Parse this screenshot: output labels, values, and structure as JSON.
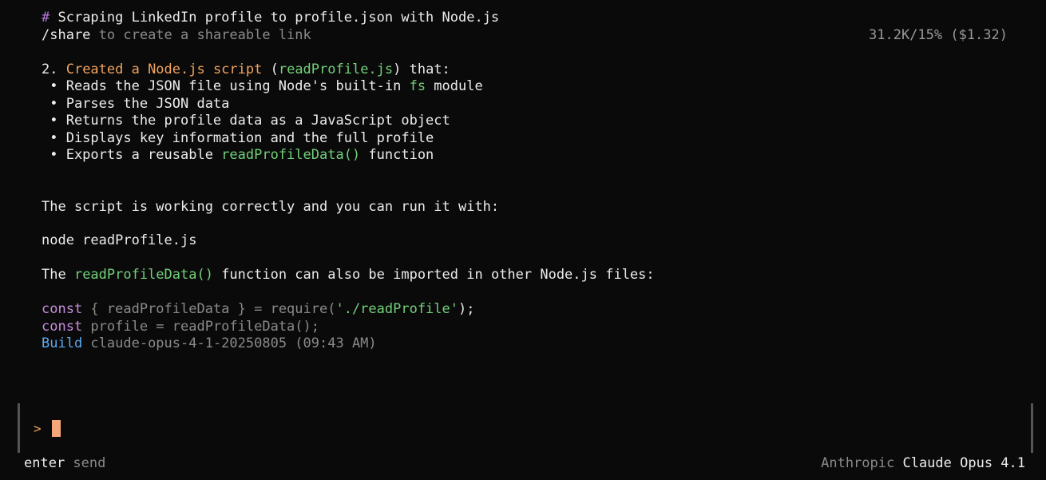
{
  "header": {
    "hash": "#",
    "title": " Scraping LinkedIn profile to profile.json with Node.js",
    "share_cmd": "/share",
    "share_hint": " to create a shareable link",
    "stats": "31.2K/15% ($1.32)"
  },
  "summary": {
    "item_num": "2. ",
    "item_title": "Created a Node.js script",
    "paren_open": " (",
    "script_file": "readProfile.js",
    "paren_close": ") that:",
    "bullets": [
      {
        "pre": " • Reads the JSON file using Node's built-in ",
        "code": "fs",
        "post": " module"
      },
      {
        "text": " • Parses the JSON data"
      },
      {
        "text": " • Returns the profile data as a JavaScript object"
      },
      {
        "text": " • Displays key information and the full profile"
      },
      {
        "pre": " • Exports a reusable ",
        "code": "readProfileData()",
        "post": " function"
      }
    ]
  },
  "body": {
    "run_intro": "The script is working correctly and you can run it with:",
    "run_cmd": "node readProfile.js",
    "import_pre": "The ",
    "import_fn": "readProfileData()",
    "import_post": " function can also be imported in other Node.js files:"
  },
  "code": {
    "line1_kw": "const",
    "line1_mid": " { readProfileData } = require(",
    "line1_str": "'./readProfile'",
    "line1_end": ");",
    "line2_kw": "const",
    "line2_rest": " profile = readProfileData();",
    "build_kw": "Build",
    "build_info": " claude-opus-4-1-20250805 (09:43 AM)"
  },
  "input": {
    "prompt": ">"
  },
  "footer": {
    "enter_label": "enter",
    "send_label": " send",
    "provider": "Anthropic",
    "model": " Claude Opus 4.1"
  },
  "colors": {
    "background": "#0a0a0a",
    "text": "#ececec",
    "accent_orange": "#f0a35e",
    "accent_green": "#72d07a",
    "accent_purple": "#c58ddc",
    "accent_blue": "#5ca8ec",
    "cursor": "#f5a779"
  }
}
